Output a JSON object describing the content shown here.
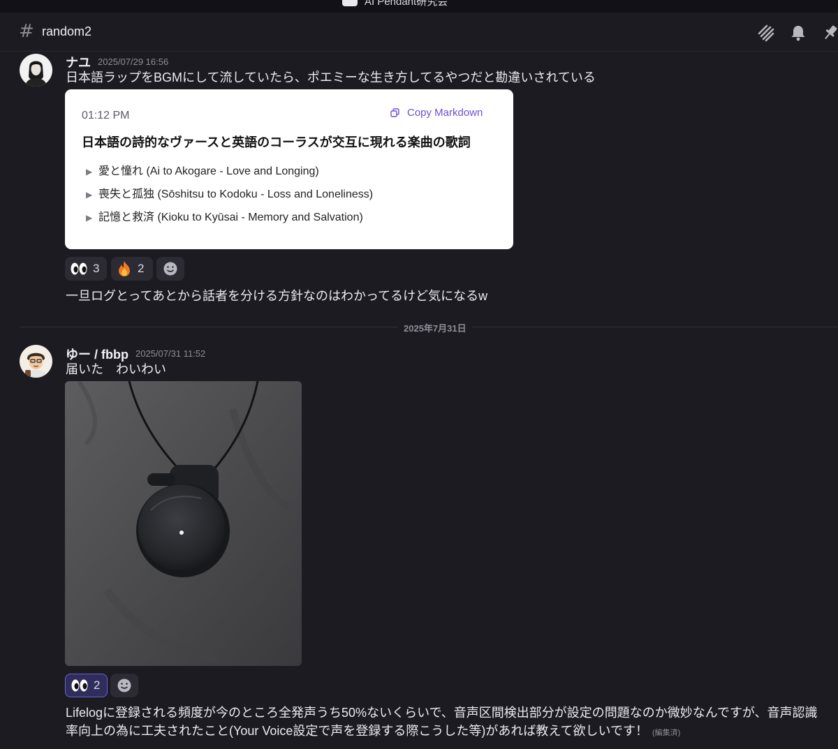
{
  "window": {
    "server_name": "AI Pendant研究会"
  },
  "header": {
    "channel_name": "random2"
  },
  "messages": [
    {
      "author": "ナユ",
      "timestamp": "2025/07/29 16:56",
      "text": "日本語ラップをBGMにして流していたら、ポエミーな生き方してるやつだと勘違いされている",
      "embed": {
        "time": "01:12 PM",
        "copy_label": "Copy Markdown",
        "title": "日本語の詩的なヴァースと英語のコーラスが交互に現れる楽曲の歌詞",
        "items": [
          "愛と憧れ (Ai to Akogare - Love and Longing)",
          "喪失と孤独 (Sōshitsu to Kodoku - Loss and Loneliness)",
          "記憶と救済 (Kioku to Kyūsai - Memory and Salvation)"
        ]
      },
      "reactions": [
        {
          "emoji": "eyes",
          "count": "3"
        },
        {
          "emoji": "fire",
          "count": "2"
        }
      ],
      "followup": "一旦ログとってあとから話者を分ける方針なのはわかってるけど気になるw"
    },
    {
      "author": "ゆー / fbbp",
      "timestamp": "2025/07/31 11:52",
      "text": "届いた　わいわい",
      "reactions": [
        {
          "emoji": "eyes",
          "count": "2",
          "active": true
        }
      ],
      "followup_line1": "Lifelogに登録される頻度が今のところ全発声うち50%ないくらいで、音声区間検出部分が設定の問題なのか微妙なんですが、音声認識",
      "followup_line2": "率向上の為に工夫されたこと(Your Voice設定で声を登録する際こうした等)があれば教えて欲しいです！",
      "edited_label": "(編集済)"
    }
  ],
  "date_divider": "2025年7月31日",
  "icons": {
    "header": [
      "threads-icon",
      "bell-icon",
      "pin-icon"
    ],
    "add_reaction": "smiley-icon"
  }
}
